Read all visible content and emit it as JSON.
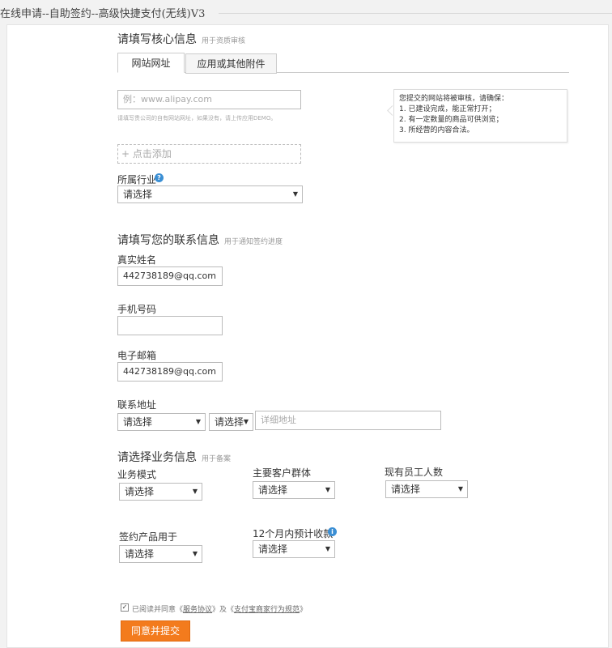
{
  "page": {
    "title": "在线申请--自助签约--高级快捷支付(无线)V3"
  },
  "core": {
    "title": "请填写核心信息",
    "subtitle": "用于资质审核",
    "tabs": [
      {
        "label": "网站网址",
        "active": true
      },
      {
        "label": "应用或其他附件",
        "active": false
      }
    ],
    "url_input": {
      "value": "",
      "placeholder": "例：www.alipay.com"
    },
    "url_hint": "请填写贵公司的自有网站网址，如果没有，请上传应用DEMO。",
    "add_label": "+ 点击添加",
    "tip": {
      "heading": "您提交的网站将被审核，请确保：",
      "items": [
        "1. 已建设完成，能正常打开；",
        "2. 有一定数量的商品可供浏览；",
        "3. 所经营的内容合法。"
      ]
    },
    "industry": {
      "label": "所属行业",
      "value": "请选择",
      "help_icon": "question-icon"
    }
  },
  "contact": {
    "title": "请填写您的联系信息",
    "subtitle": "用于通知签约进度",
    "name": {
      "label": "真实姓名",
      "value": "442738189@qq.com"
    },
    "phone": {
      "label": "手机号码",
      "value": ""
    },
    "email": {
      "label": "电子邮箱",
      "value": "442738189@qq.com"
    },
    "address": {
      "label": "联系地址",
      "province": "请选择",
      "city": "请选择",
      "detail_placeholder": "详细地址"
    }
  },
  "business": {
    "title": "请选择业务信息",
    "subtitle": "用于备案",
    "model": {
      "label": "业务模式",
      "value": "请选择"
    },
    "customers": {
      "label": "主要客户群体",
      "value": "请选择"
    },
    "staff": {
      "label": "现有员工人数",
      "value": "请选择"
    },
    "product_use": {
      "label": "签约产品用于",
      "value": "请选择"
    },
    "collection": {
      "label": "12个月内预计收款",
      "value": "请选择",
      "info_icon": "info-icon"
    }
  },
  "agreement": {
    "checked": true,
    "prefix": "已阅读并同意《",
    "link1": "服务协议",
    "middle": "》及《",
    "link2": "支付宝商家行为规范",
    "suffix": "》"
  },
  "submit_label": "同意并提交",
  "colors": {
    "accent": "#f37b1d",
    "link_icon": "#3b8fd4"
  }
}
